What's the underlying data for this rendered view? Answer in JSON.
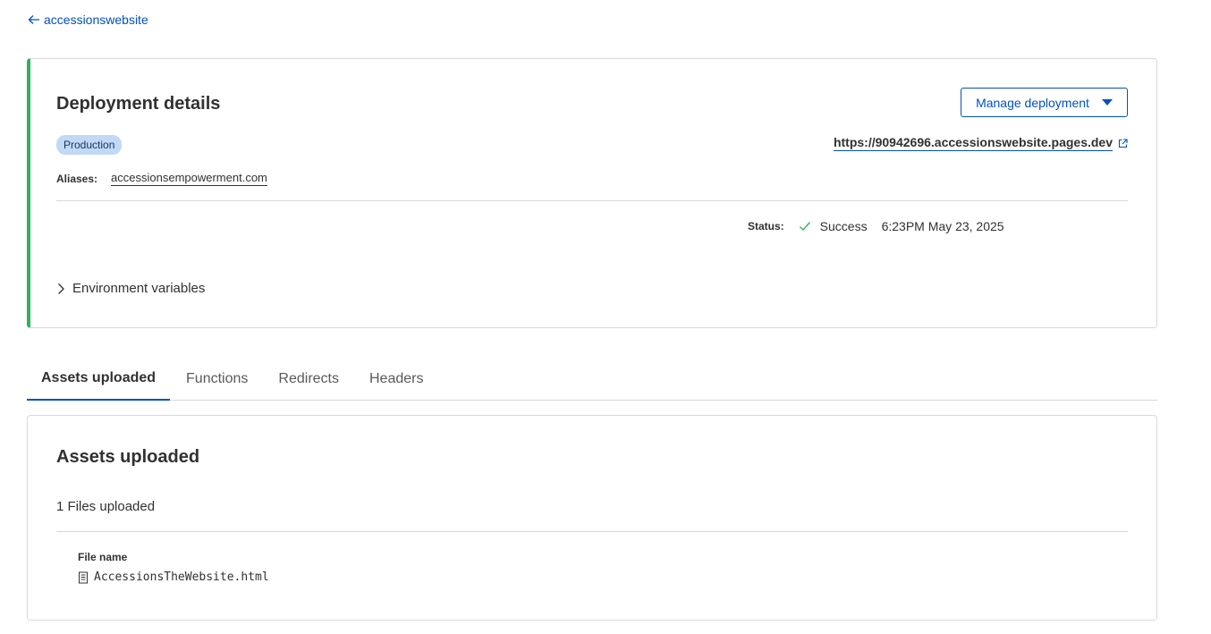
{
  "back_link": {
    "label": "accessionswebsite"
  },
  "deployment": {
    "title": "Deployment details",
    "manage_button": "Manage deployment",
    "environment": "Production",
    "url": "https://90942696.accessionswebsite.pages.dev",
    "aliases_label": "Aliases:",
    "alias": "accessionsempowerment.com",
    "status_label": "Status:",
    "status_value": "Success",
    "status_time": "6:23PM May 23, 2025",
    "status_color": "#2db35d",
    "env_variables_label": "Environment variables"
  },
  "tabs": [
    {
      "label": "Assets uploaded",
      "active": true
    },
    {
      "label": "Functions",
      "active": false
    },
    {
      "label": "Redirects",
      "active": false
    },
    {
      "label": "Headers",
      "active": false
    }
  ],
  "assets": {
    "title": "Assets uploaded",
    "files_count": "1 Files uploaded",
    "column_header": "File name",
    "files": [
      {
        "name": "AccessionsTheWebsite.html",
        "icon": "file-icon"
      }
    ]
  },
  "colors": {
    "accent": "#0051c3",
    "success": "#2db35d",
    "badge_bg": "#c1d8f7"
  }
}
